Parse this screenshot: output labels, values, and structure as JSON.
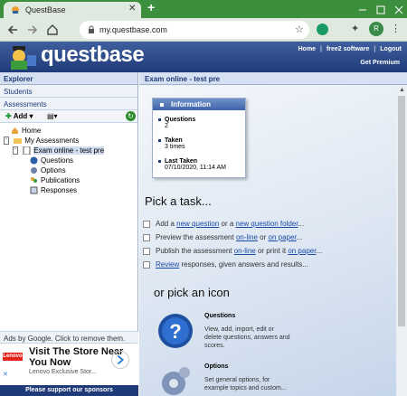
{
  "browser": {
    "tab_title": "QuestBase",
    "new_tab": "+",
    "url": "my.questbase.com",
    "profile_initial": "R"
  },
  "header": {
    "logo": "questbase",
    "links": [
      "Home",
      "free2 software",
      "Logout"
    ],
    "premium": "Get Premium"
  },
  "sidebar": {
    "title": "Explorer",
    "sections": [
      "Students",
      "Assessments"
    ],
    "add_label": "Add",
    "tree": [
      {
        "label": "Home",
        "icon": "home-icon"
      },
      {
        "label": "My Assessments",
        "icon": "folder-icon"
      },
      {
        "label": "Exam online - test pre",
        "icon": "document-icon",
        "selected": true
      },
      {
        "label": "Questions",
        "icon": "question-icon"
      },
      {
        "label": "Options",
        "icon": "gear-icon"
      },
      {
        "label": "Publications",
        "icon": "users-icon"
      },
      {
        "label": "Responses",
        "icon": "responses-icon"
      }
    ],
    "ads_label": "Ads by Google. Click to remove them.",
    "ad": {
      "brand": "Lenovo",
      "title": "Visit The Store Near You Now",
      "subtitle": "Lenovo Exclusive Stor..."
    },
    "support": "Please support our sponsors"
  },
  "main": {
    "title": "Exam online - test pre",
    "info": {
      "title": "Information",
      "rows": [
        {
          "k": "Questions",
          "v": "2"
        },
        {
          "k": "Taken",
          "v": "3 times"
        },
        {
          "k": "Last Taken",
          "v": "07/10/2020, 11:14 AM"
        }
      ]
    },
    "pick_task": "Pick a task...",
    "tasks": [
      {
        "prefix": "Add a ",
        "link1": "new question",
        "mid": " or a ",
        "link2": "new question folder",
        "suffix": "..."
      },
      {
        "prefix": "Preview the assessment ",
        "link1": "on-line",
        "mid": " or ",
        "link2": "on paper",
        "suffix": "..."
      },
      {
        "prefix": "Publish the assessment ",
        "link1": "on-line",
        "mid": " or print it ",
        "link2": "on paper",
        "suffix": "..."
      },
      {
        "prefix": "",
        "link1": "Review",
        "mid": " responses, given answers and results...",
        "link2": "",
        "suffix": ""
      }
    ],
    "pick_icon": "or pick an icon",
    "features": [
      {
        "title": "Questions",
        "desc": "View, add, import, edit or delete questions, answers and scores."
      },
      {
        "title": "Options",
        "desc": "Set general options, for example topics and custom..."
      }
    ]
  }
}
